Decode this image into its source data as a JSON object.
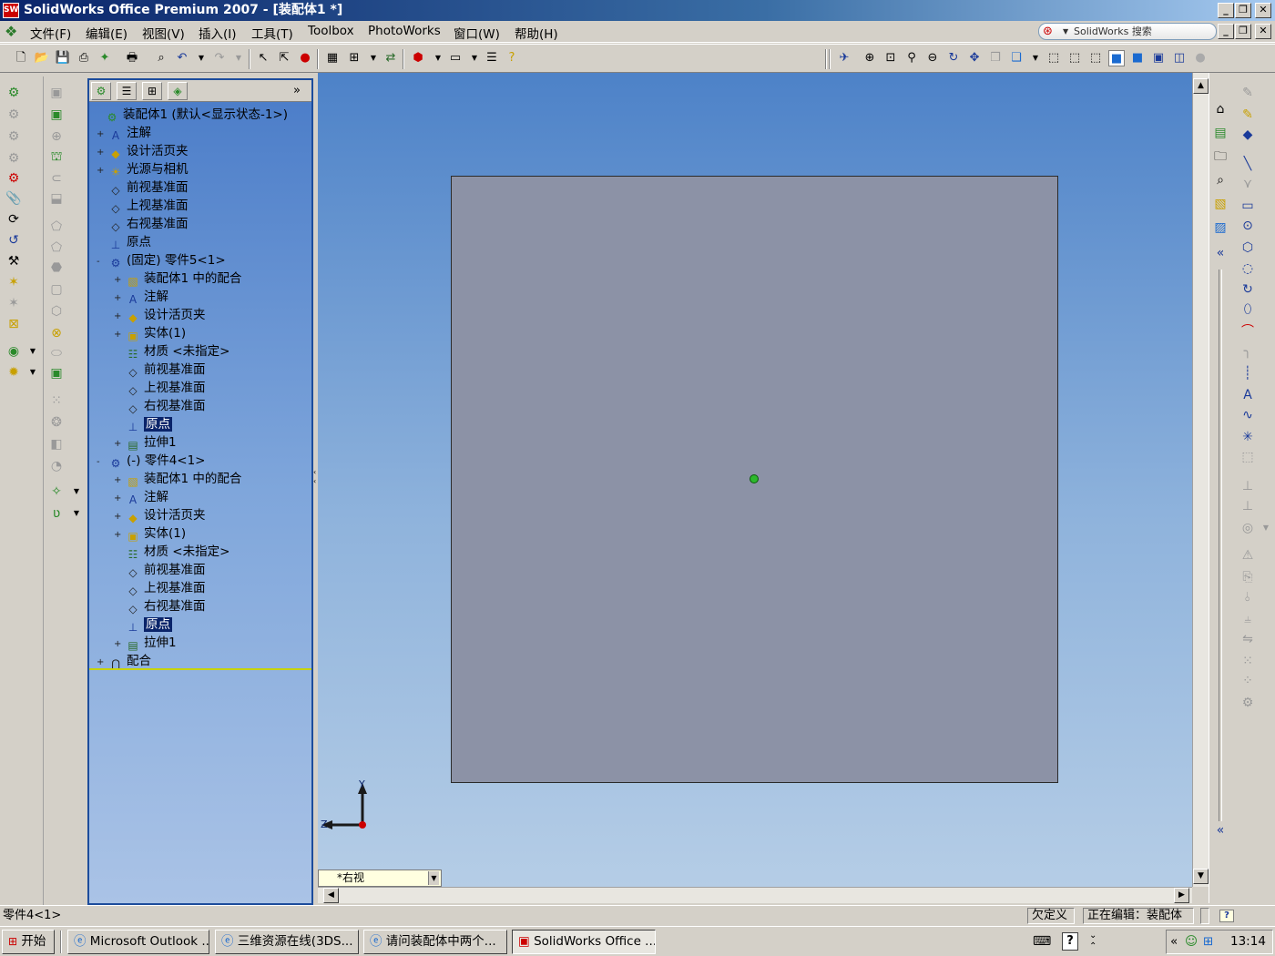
{
  "window": {
    "title": "SolidWorks Office Premium 2007 - [装配体1 *]",
    "logo_text": "SW"
  },
  "menu": [
    "文件(F)",
    "编辑(E)",
    "视图(V)",
    "插入(I)",
    "工具(T)",
    "Toolbox",
    "PhotoWorks",
    "窗口(W)",
    "帮助(H)"
  ],
  "search": {
    "placeholder": "SolidWorks 搜索"
  },
  "tree": {
    "root": "装配体1 (默认<显示状态-1>)",
    "items": [
      {
        "label": "注解",
        "expander": "+",
        "icon": "annotation-icon"
      },
      {
        "label": "设计活页夹",
        "expander": "+",
        "icon": "design-binder-icon"
      },
      {
        "label": "光源与相机",
        "expander": "+",
        "icon": "lights-cameras-icon"
      },
      {
        "label": "前视基准面",
        "expander": "",
        "icon": "plane-icon"
      },
      {
        "label": "上视基准面",
        "expander": "",
        "icon": "plane-icon"
      },
      {
        "label": "右视基准面",
        "expander": "",
        "icon": "plane-icon"
      },
      {
        "label": "原点",
        "expander": "",
        "icon": "origin-icon"
      },
      {
        "label": "(固定) 零件5<1>",
        "expander": "-",
        "icon": "part-icon"
      },
      {
        "label": "装配体1 中的配合",
        "expander": "+",
        "icon": "mates-folder-icon"
      },
      {
        "label": "注解",
        "expander": "+",
        "icon": "annotation-icon"
      },
      {
        "label": "设计活页夹",
        "expander": "+",
        "icon": "design-binder-icon"
      },
      {
        "label": "实体(1)",
        "expander": "+",
        "icon": "solid-bodies-icon"
      },
      {
        "label": "材质 <未指定>",
        "expander": "",
        "icon": "material-icon"
      },
      {
        "label": "前视基准面",
        "expander": "",
        "icon": "plane-icon"
      },
      {
        "label": "上视基准面",
        "expander": "",
        "icon": "plane-icon"
      },
      {
        "label": "右视基准面",
        "expander": "",
        "icon": "plane-icon"
      },
      {
        "label": "原点",
        "expander": "",
        "icon": "origin-icon",
        "selected": true
      },
      {
        "label": "拉伸1",
        "expander": "+",
        "icon": "extrude-icon"
      },
      {
        "label": "(-) 零件4<1>",
        "expander": "-",
        "icon": "part-icon"
      },
      {
        "label": "装配体1 中的配合",
        "expander": "+",
        "icon": "mates-folder-icon"
      },
      {
        "label": "注解",
        "expander": "+",
        "icon": "annotation-icon"
      },
      {
        "label": "设计活页夹",
        "expander": "+",
        "icon": "design-binder-icon"
      },
      {
        "label": "实体(1)",
        "expander": "+",
        "icon": "solid-bodies-icon"
      },
      {
        "label": "材质 <未指定>",
        "expander": "",
        "icon": "material-icon"
      },
      {
        "label": "前视基准面",
        "expander": "",
        "icon": "plane-icon"
      },
      {
        "label": "上视基准面",
        "expander": "",
        "icon": "plane-icon"
      },
      {
        "label": "右视基准面",
        "expander": "",
        "icon": "plane-icon"
      },
      {
        "label": "原点",
        "expander": "",
        "icon": "origin-icon",
        "selected": true
      },
      {
        "label": "拉伸1",
        "expander": "+",
        "icon": "extrude-icon"
      },
      {
        "label": "配合",
        "expander": "+",
        "icon": "mates-icon"
      }
    ]
  },
  "viewport": {
    "view_name": "*右视",
    "triad_y": "Y",
    "triad_z": "Z",
    "part_color": "#8c92a6",
    "origin_color": "#2db82d"
  },
  "status": {
    "left": "零件4<1>",
    "definition": "欠定义",
    "editing": "正在编辑：装配体",
    "help": "?"
  },
  "taskbar": {
    "start": "开始",
    "tasks": [
      "Microsoft Outlook ...",
      "三维资源在线(3DS...",
      "请问装配体中两个...",
      "SolidWorks Office ..."
    ],
    "time": "13:14"
  }
}
